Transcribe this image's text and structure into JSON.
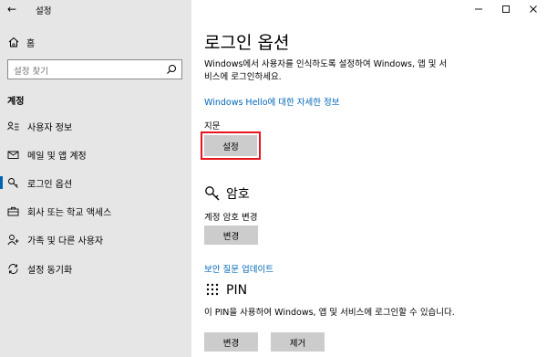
{
  "window": {
    "title": "설정"
  },
  "sidebar": {
    "home_label": "홈",
    "search_placeholder": "설정 찾기",
    "section_title": "계정",
    "items": [
      {
        "label": "사용자 정보",
        "icon": "user-info-icon",
        "selected": false
      },
      {
        "label": "메일 및 앱 계정",
        "icon": "mail-icon",
        "selected": false
      },
      {
        "label": "로그인 옵션",
        "icon": "key-icon",
        "selected": true
      },
      {
        "label": "회사 또는 학교 액세스",
        "icon": "briefcase-icon",
        "selected": false
      },
      {
        "label": "가족 및 다른 사용자",
        "icon": "person-add-icon",
        "selected": false
      },
      {
        "label": "설정 동기화",
        "icon": "sync-icon",
        "selected": false
      }
    ]
  },
  "main": {
    "title": "로그인 옵션",
    "description_line1": "Windows에서 사용자를 인식하도록 설정하여 Windows, 앱 및 서",
    "description_line2": "비스에 로그인하세요.",
    "hello_link": "Windows Hello에 대한 자세한 정보",
    "fingerprint": {
      "label": "지문",
      "setup_button": "설정"
    },
    "password": {
      "heading": "암호",
      "change_label": "계정 암호 변경",
      "change_button": "변경",
      "security_questions_link": "보안 질문 업데이트"
    },
    "pin": {
      "heading": "PIN",
      "description": "이 PIN을 사용하여 Windows, 앱 및 서비스에 로그인할 수 있습니다.",
      "change_button": "변경",
      "remove_button": "제거"
    }
  },
  "colors": {
    "accent": "#0067b8",
    "highlight": "#e8161c",
    "sidebar_bg": "#e6e6e6",
    "button_bg": "#cccccc"
  }
}
